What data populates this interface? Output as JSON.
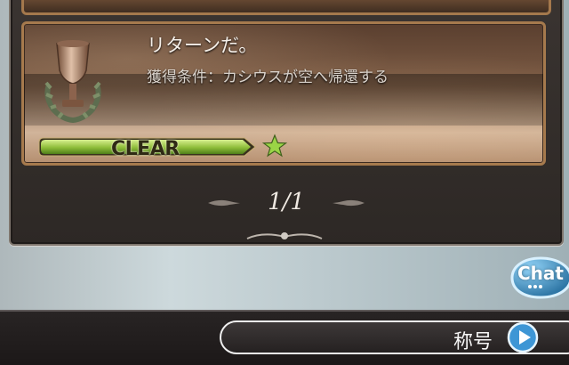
{
  "achievement": {
    "title": "リターンだ。",
    "condition": "獲得条件：カシウスが空へ帰還する",
    "status": "CLEAR",
    "completion_percent": 100
  },
  "pagination": {
    "text": "1/1"
  },
  "chat": {
    "label": "Chat"
  },
  "title_button": {
    "label": "称号"
  },
  "colors": {
    "accent_gold": "#a67a4d",
    "clear_green": "#8ebd39",
    "chat_blue": "#3b90c3"
  },
  "icons": {
    "trophy": "trophy-icon",
    "star": "star-icon",
    "play": "play-icon"
  }
}
